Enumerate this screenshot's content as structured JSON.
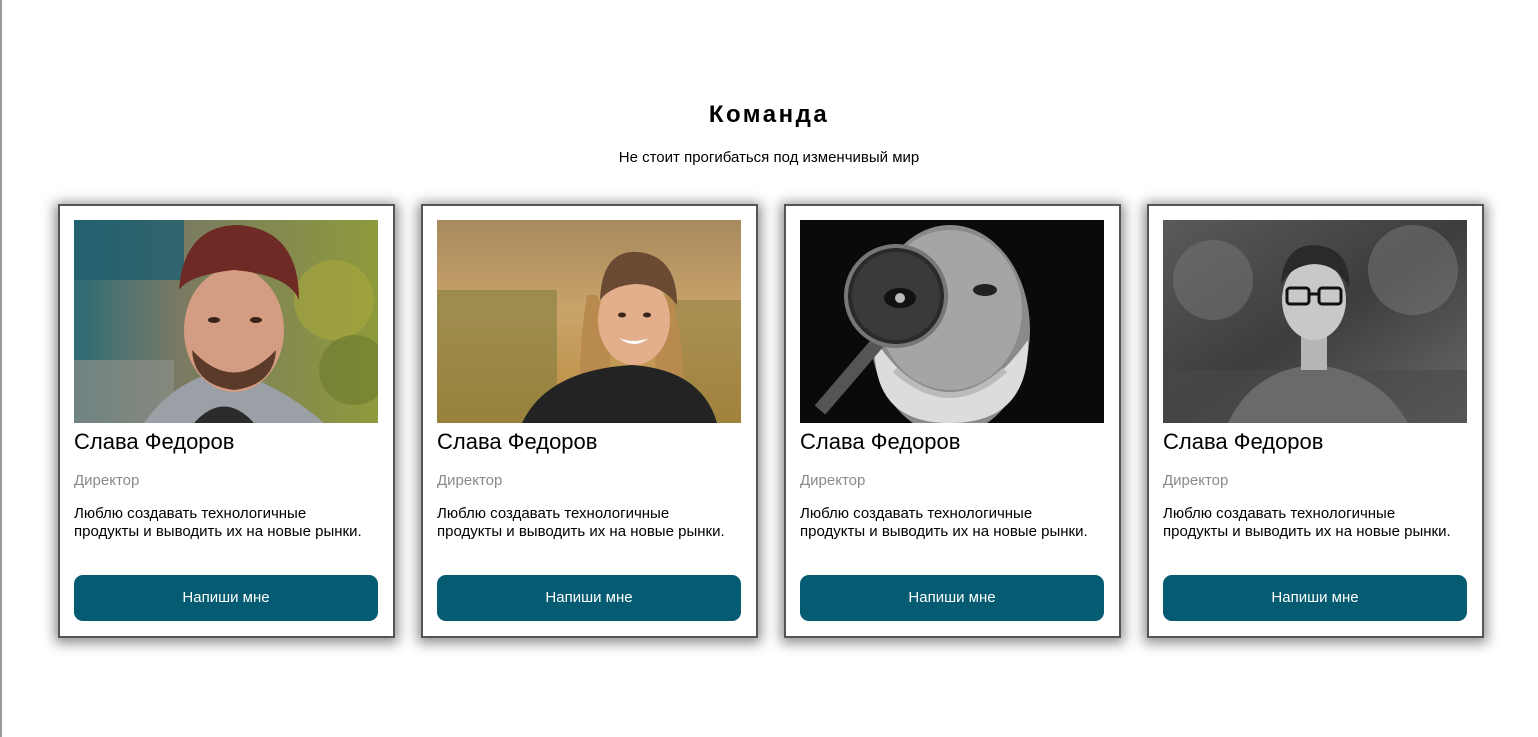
{
  "team_section": {
    "title": "Команда",
    "subtitle": "Не стоит прогибаться под изменчивый мир"
  },
  "colors": {
    "button_bg": "#045b72",
    "button_text": "#ffffff",
    "role_text": "#8a8a8a",
    "card_border": "#555555"
  },
  "members": [
    {
      "name": "Слава Федоров",
      "role": "Директор",
      "bio": "Люблю создавать технологичные продукты и выводить их на новые рынки.",
      "button": "Напиши мне",
      "photo": "man-in-beanie-photo"
    },
    {
      "name": "Слава Федоров",
      "role": "Директор",
      "bio": "Люблю создавать технологичные продукты и выводить их на новые рынки.",
      "button": "Напиши мне",
      "photo": "woman-in-beanie-photo"
    },
    {
      "name": "Слава Федоров",
      "role": "Директор",
      "bio": "Люблю создавать технологичные продукты и выводить их на новые рынки.",
      "button": "Напиши мне",
      "photo": "old-man-magnifier-photo"
    },
    {
      "name": "Слава Федоров",
      "role": "Директор",
      "bio": "Люблю создавать технологичные продукты и выводить их на новые рынки.",
      "button": "Напиши мне",
      "photo": "young-man-glasses-photo"
    }
  ]
}
